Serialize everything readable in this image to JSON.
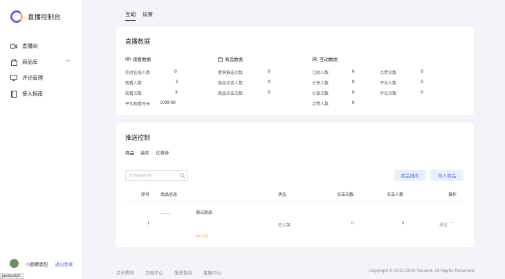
{
  "app": {
    "title": "直播控制台"
  },
  "sidebar": {
    "items": [
      {
        "label": "直播间",
        "icon": "video-icon"
      },
      {
        "label": "商品库",
        "icon": "bag-icon"
      },
      {
        "label": "评论管理",
        "icon": "monitor-icon"
      },
      {
        "label": "接入指南",
        "icon": "book-icon"
      }
    ]
  },
  "user": {
    "name": "小圆要面包",
    "logout": "退出登录"
  },
  "status_tooltip": "javascript:;",
  "top_tabs": [
    {
      "label": "互动",
      "active": true
    },
    {
      "label": "设置",
      "active": false
    }
  ],
  "live_data": {
    "title": "直播数据",
    "watch": {
      "header": "观看数据",
      "stats": [
        {
          "label": "实时在线人数",
          "value": "0"
        },
        {
          "label": "观看人数",
          "value": "1"
        },
        {
          "label": "观看次数",
          "value": "3"
        },
        {
          "label": "平均观看时长",
          "value": "0:00:00"
        }
      ]
    },
    "goods": {
      "header": "商品数据",
      "stats": [
        {
          "label": "累积推送次数",
          "value": "0"
        },
        {
          "label": "商品点击人数",
          "value": "0"
        },
        {
          "label": "商品点击次数",
          "value": "0"
        }
      ]
    },
    "interact": {
      "header": "互动数据",
      "col1": [
        {
          "label": "订阅人数",
          "value": "0"
        },
        {
          "label": "分享人数",
          "value": "0"
        },
        {
          "label": "分享次数",
          "value": "0"
        },
        {
          "label": "点赞人数",
          "value": "0"
        }
      ],
      "col2": [
        {
          "label": "点赞次数",
          "value": "0"
        },
        {
          "label": "评论人数",
          "value": "0"
        },
        {
          "label": "评论次数",
          "value": "0"
        }
      ]
    }
  },
  "push": {
    "title": "推送控制",
    "tabs": [
      {
        "label": "商品",
        "active": true
      },
      {
        "label": "抽奖",
        "active": false
      },
      {
        "label": "优惠券",
        "active": false
      }
    ],
    "search_placeholder": "查找商品名称",
    "sort_button": "商品排序",
    "import_button": "导入商品",
    "columns": [
      "序号",
      "商品信息",
      "状态",
      "点击次数",
      "点击人数",
      "操作"
    ],
    "rows": [
      {
        "index": "1",
        "thumb": "— —",
        "name": "测试商品",
        "price": "0.01元",
        "status": "已上架",
        "clicks": "0",
        "clickers": "0",
        "action": "推送",
        "more": "···"
      }
    ]
  },
  "footer": {
    "links": [
      "关于腾讯",
      "文档中心",
      "服务协议",
      "客服中心"
    ],
    "copyright": "Copyright © 2012-2020 Tencent. All Rights Reserved."
  },
  "colors": {
    "accent": "#4a6ee0",
    "price": "#e6a23c",
    "background": "#f3f4f7"
  }
}
